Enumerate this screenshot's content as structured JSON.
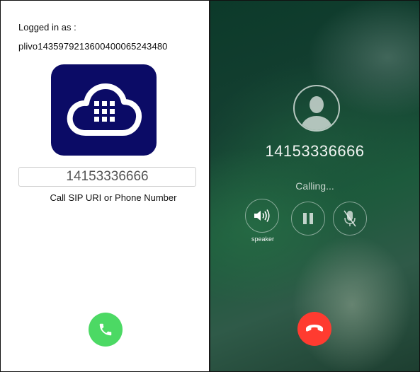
{
  "dialer": {
    "logged_label": "Logged in as :",
    "username": "plivo1435979213600400065243480",
    "number_value": "14153336666",
    "number_placeholder": "",
    "hint": "Call SIP URI or Phone Number",
    "call_icon": "phone-icon",
    "logo_icon": "cloud-keypad-icon",
    "call_color": "#4cd964",
    "logo_color": "#0b0b66"
  },
  "call_screen": {
    "callee_number": "14153336666",
    "status": "Calling...",
    "avatar_icon": "person-icon",
    "controls": [
      {
        "icon": "speaker-icon",
        "label": "speaker"
      },
      {
        "icon": "pause-icon",
        "label": ""
      },
      {
        "icon": "mute-icon",
        "label": ""
      }
    ],
    "hangup_icon": "phone-hangup-icon",
    "hangup_color": "#ff3b30"
  }
}
